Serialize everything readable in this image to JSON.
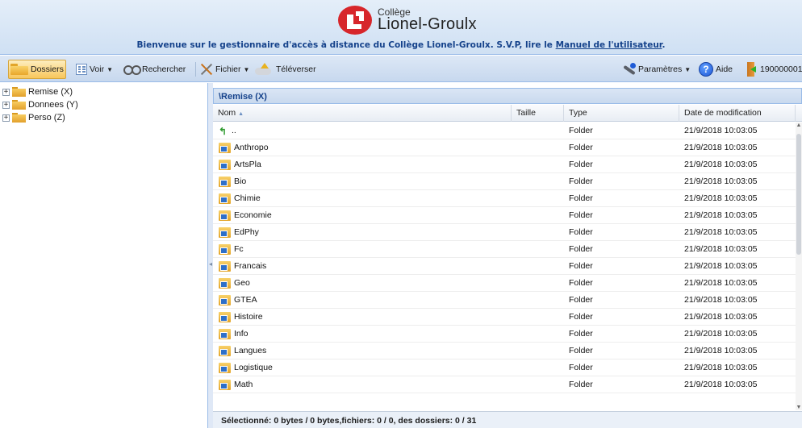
{
  "header": {
    "logo_small": "Collège",
    "logo_big": "Lionel-Groulx",
    "welcome_text": "Bienvenue sur le gestionnaire d'accès à distance du Collège Lionel-Groulx. S.V.P, lire le ",
    "manual_link": "Manuel de l'utilisateur",
    "welcome_end": "."
  },
  "toolbar": {
    "dossiers": "Dossiers",
    "voir": "Voir",
    "rechercher": "Rechercher",
    "fichier": "Fichier",
    "televerser": "Téléverser",
    "parametres": "Paramètres",
    "aide": "Aide",
    "user_id": "190000001"
  },
  "tree": [
    {
      "label": "Remise (X)"
    },
    {
      "label": "Donnees (Y)"
    },
    {
      "label": "Perso (Z)"
    }
  ],
  "panel": {
    "title": "\\Remise (X)",
    "columns": {
      "name": "Nom",
      "sort": "▲",
      "size": "Taille",
      "type": "Type",
      "date": "Date de modification"
    }
  },
  "rows": [
    {
      "name": "..",
      "type": "Folder",
      "date": "21/9/2018 10:03:05",
      "icon": "up-arrow-icon"
    },
    {
      "name": "Anthropo",
      "type": "Folder",
      "date": "21/9/2018 10:03:05",
      "icon": "network-folder-icon"
    },
    {
      "name": "ArtsPla",
      "type": "Folder",
      "date": "21/9/2018 10:03:05",
      "icon": "network-folder-icon"
    },
    {
      "name": "Bio",
      "type": "Folder",
      "date": "21/9/2018 10:03:05",
      "icon": "network-folder-icon"
    },
    {
      "name": "Chimie",
      "type": "Folder",
      "date": "21/9/2018 10:03:05",
      "icon": "network-folder-icon"
    },
    {
      "name": "Economie",
      "type": "Folder",
      "date": "21/9/2018 10:03:05",
      "icon": "network-folder-icon"
    },
    {
      "name": "EdPhy",
      "type": "Folder",
      "date": "21/9/2018 10:03:05",
      "icon": "network-folder-icon"
    },
    {
      "name": "Fc",
      "type": "Folder",
      "date": "21/9/2018 10:03:05",
      "icon": "network-folder-icon"
    },
    {
      "name": "Francais",
      "type": "Folder",
      "date": "21/9/2018 10:03:05",
      "icon": "network-folder-icon"
    },
    {
      "name": "Geo",
      "type": "Folder",
      "date": "21/9/2018 10:03:05",
      "icon": "network-folder-icon"
    },
    {
      "name": "GTEA",
      "type": "Folder",
      "date": "21/9/2018 10:03:05",
      "icon": "network-folder-icon"
    },
    {
      "name": "Histoire",
      "type": "Folder",
      "date": "21/9/2018 10:03:05",
      "icon": "network-folder-icon"
    },
    {
      "name": "Info",
      "type": "Folder",
      "date": "21/9/2018 10:03:05",
      "icon": "network-folder-icon"
    },
    {
      "name": "Langues",
      "type": "Folder",
      "date": "21/9/2018 10:03:05",
      "icon": "network-folder-icon"
    },
    {
      "name": "Logistique",
      "type": "Folder",
      "date": "21/9/2018 10:03:05",
      "icon": "network-folder-icon"
    },
    {
      "name": "Math",
      "type": "Folder",
      "date": "21/9/2018 10:03:05",
      "icon": "network-folder-icon"
    }
  ],
  "status": "Sélectionné: 0 bytes / 0 bytes,fichiers: 0 / 0, des dossiers: 0 / 31",
  "colors": {
    "accent": "#15428b",
    "logo_red": "#d7262b",
    "active_btn": "#f8c65c"
  }
}
